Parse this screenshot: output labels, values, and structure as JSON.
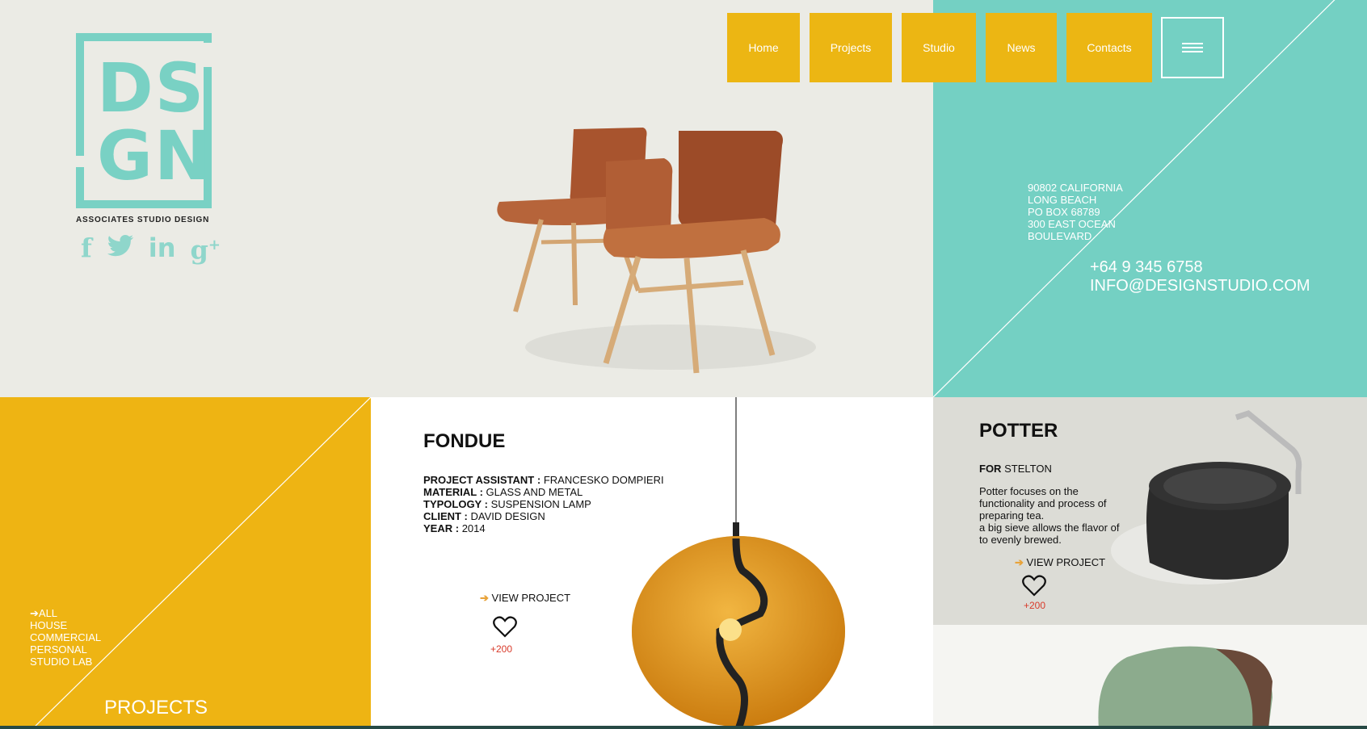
{
  "brand": {
    "logo_letters_top": "DS",
    "logo_letters_bottom": "GN",
    "tagline": "ASSOCIATES STUDIO DESIGN",
    "logo_color": "#79d1c4"
  },
  "social": [
    {
      "icon": "facebook-icon",
      "glyph": "f"
    },
    {
      "icon": "twitter-icon",
      "glyph": "🐦"
    },
    {
      "icon": "linkedin-icon",
      "glyph": "in"
    },
    {
      "icon": "googleplus-icon",
      "glyph": "g+"
    }
  ],
  "nav": {
    "items": [
      "Home",
      "Projects",
      "Studio",
      "News",
      "Contacts"
    ],
    "menu_icon": "hamburger-icon",
    "color": "#ecb613"
  },
  "contact": {
    "address": [
      "90802 CALIFORNIA",
      "LONG BEACH",
      "PO BOX 68789",
      "300 EAST OCEAN",
      "BOULEVARD"
    ],
    "phone": "+64 9 345 6758",
    "email": "INFO@DESIGNSTUDIO.COM",
    "panel_color": "#74d0c3"
  },
  "projects_panel": {
    "filters": [
      "ALL",
      "HOUSE",
      "COMMERCIAL",
      "PERSONAL",
      "STUDIO LAB"
    ],
    "title": "PROJECTS",
    "color": "#eeb413"
  },
  "fondue": {
    "title": "FONDUE",
    "specs": [
      {
        "label": "PROJECT ASSISTANT :",
        "value": "FRANCESKO DOMPIERI"
      },
      {
        "label": "MATERIAL :",
        "value": "GLASS AND METAL"
      },
      {
        "label": "TYPOLOGY :",
        "value": "SUSPENSION LAMP"
      },
      {
        "label": "CLIENT :",
        "value": "DAVID DESIGN"
      },
      {
        "label": "YEAR :",
        "value": "2014"
      }
    ],
    "view_label": "VIEW PROJECT",
    "likes": "+200"
  },
  "potter": {
    "title": "POTTER",
    "for_label": "FOR",
    "for_value": "STELTON",
    "description_lines": [
      "Potter focuses on the",
      "functionality and process of",
      "preparing tea.",
      "a big sieve allows the flavor of",
      "to evenly brewed."
    ],
    "view_label": "VIEW PROJECT",
    "likes": "+200"
  }
}
